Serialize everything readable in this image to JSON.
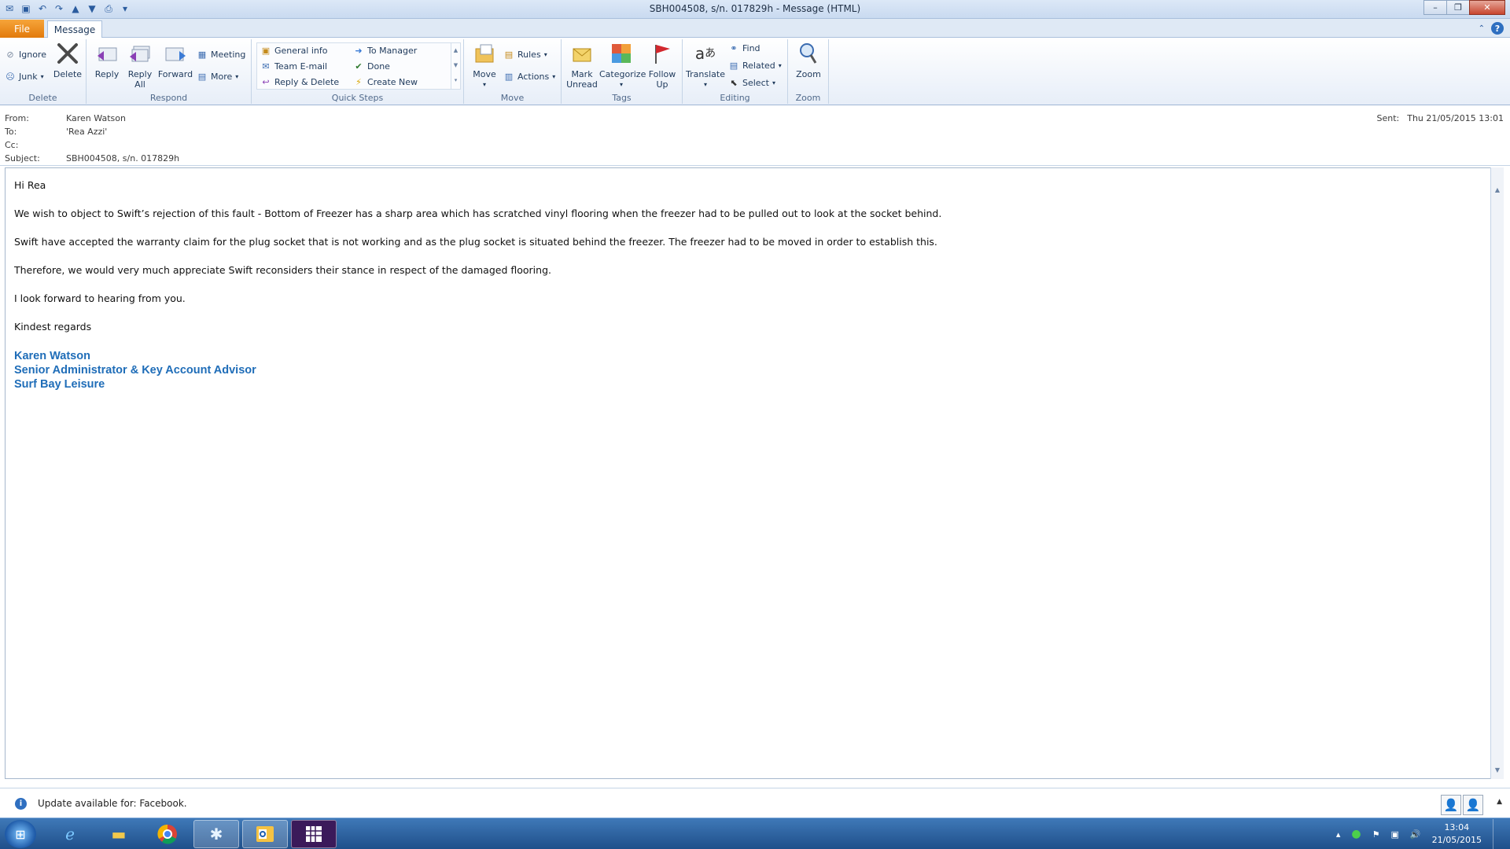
{
  "window": {
    "title": "SBH004508, s/n. 017829h  -  Message (HTML)",
    "controls": {
      "minimize": "–",
      "restore": "❐",
      "close": "✕"
    }
  },
  "tabs": {
    "file": "File",
    "message": "Message"
  },
  "ribbon": {
    "delete": {
      "ignore": "Ignore",
      "junk": "Junk",
      "delete": "Delete",
      "label": "Delete"
    },
    "respond": {
      "reply": "Reply",
      "reply_all": "Reply All",
      "forward": "Forward",
      "meeting": "Meeting",
      "more": "More",
      "label": "Respond"
    },
    "quicksteps": {
      "items": [
        "General info",
        "To Manager",
        "Team E-mail",
        "Done",
        "Reply & Delete",
        "Create New"
      ],
      "label": "Quick Steps"
    },
    "move": {
      "move": "Move",
      "rules": "Rules",
      "actions": "Actions",
      "label": "Move"
    },
    "tags": {
      "mark_unread": "Mark Unread",
      "categorize": "Categorize",
      "follow_up": "Follow Up",
      "label": "Tags"
    },
    "editing": {
      "translate": "Translate",
      "find": "Find",
      "related": "Related",
      "select": "Select",
      "label": "Editing"
    },
    "zoom": {
      "zoom": "Zoom",
      "label": "Zoom"
    }
  },
  "header": {
    "from_label": "From:",
    "from": "Karen Watson",
    "to_label": "To:",
    "to": "'Rea Azzi'",
    "cc_label": "Cc:",
    "cc": "",
    "subject_label": "Subject:",
    "subject": "SBH004508, s/n. 017829h",
    "sent_label": "Sent:",
    "sent": "Thu 21/05/2015 13:01"
  },
  "body": {
    "greeting": "Hi Rea",
    "p1": "We wish to object to Swift’s rejection of this fault - Bottom of Freezer has a sharp area which has scratched vinyl flooring when the freezer had to be pulled out to look at the socket behind.",
    "p2": "Swift have accepted the warranty claim for the plug socket that is not working and as the plug socket is situated behind the freezer. The freezer had to be moved in order to establish this.",
    "p3": "Therefore, we would very much appreciate Swift reconsiders their stance in respect of the damaged flooring.",
    "p4": "I look forward to hearing from you.",
    "closing": "Kindest regards",
    "sig_name": "Karen Watson",
    "sig_title": "Senior Administrator & Key Account Advisor",
    "sig_company": "Surf Bay Leisure"
  },
  "infobar": {
    "text": "Update available for: Facebook."
  },
  "taskbar": {
    "time": "13:04",
    "date": "21/05/2015"
  }
}
